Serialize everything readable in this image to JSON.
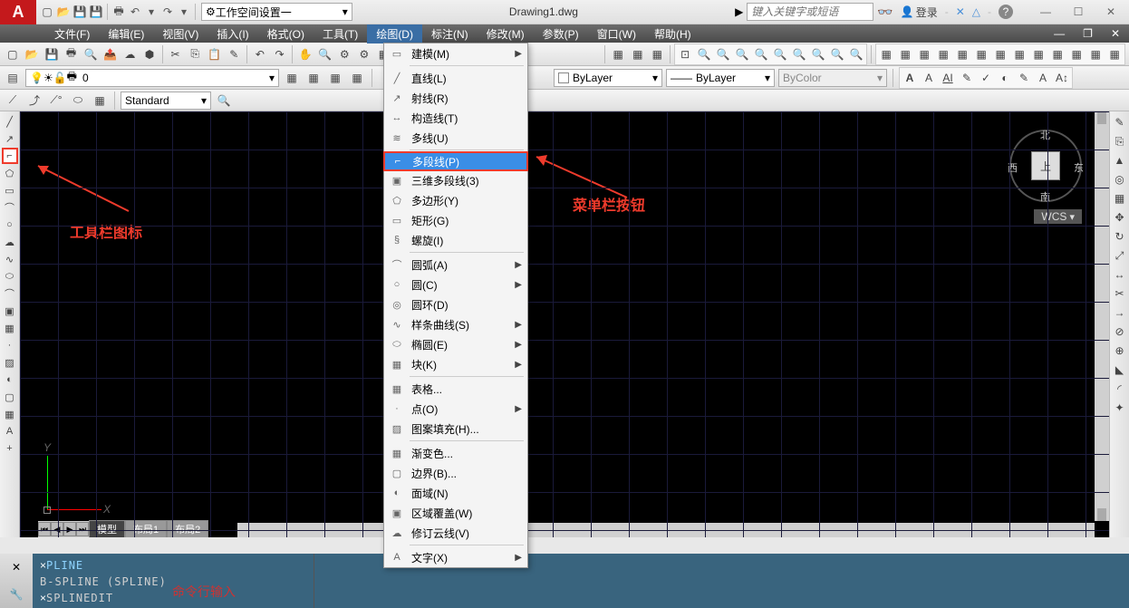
{
  "title": "Drawing1.dwg",
  "workspace": "工作空间设置一",
  "search_placeholder": "键入关键字或短语",
  "login": "登录",
  "menubar": [
    "文件(F)",
    "编辑(E)",
    "视图(V)",
    "插入(I)",
    "格式(O)",
    "工具(T)",
    "绘图(D)",
    "标注(N)",
    "修改(M)",
    "参数(P)",
    "窗口(W)",
    "帮助(H)"
  ],
  "active_menu_index": 6,
  "layer": {
    "current": "0"
  },
  "props": {
    "bylayer1": "ByLayer",
    "bylayer2": "ByLayer",
    "bycolor": "ByColor"
  },
  "style": {
    "standard": "Standard"
  },
  "dropdown": {
    "items": [
      {
        "icon": "▭",
        "label": "建模(M)",
        "arrow": true
      },
      {
        "sep": true
      },
      {
        "icon": "╱",
        "label": "直线(L)"
      },
      {
        "icon": "↗",
        "label": "射线(R)"
      },
      {
        "icon": "↔",
        "label": "构造线(T)"
      },
      {
        "icon": "≋",
        "label": "多线(U)"
      },
      {
        "sep": true
      },
      {
        "icon": "⌐",
        "label": "多段线(P)",
        "highlighted": true
      },
      {
        "icon": "▣",
        "label": "三维多段线(3)"
      },
      {
        "icon": "⬠",
        "label": "多边形(Y)"
      },
      {
        "icon": "▭",
        "label": "矩形(G)"
      },
      {
        "icon": "§",
        "label": "螺旋(I)"
      },
      {
        "sep": true
      },
      {
        "icon": "⌒",
        "label": "圆弧(A)",
        "arrow": true
      },
      {
        "icon": "○",
        "label": "圆(C)",
        "arrow": true
      },
      {
        "icon": "◎",
        "label": "圆环(D)"
      },
      {
        "icon": "∿",
        "label": "样条曲线(S)",
        "arrow": true
      },
      {
        "icon": "⬭",
        "label": "椭圆(E)",
        "arrow": true
      },
      {
        "icon": "▦",
        "label": "块(K)",
        "arrow": true
      },
      {
        "sep": true
      },
      {
        "icon": "▦",
        "label": "表格..."
      },
      {
        "icon": "·",
        "label": "点(O)",
        "arrow": true
      },
      {
        "icon": "▨",
        "label": "图案填充(H)..."
      },
      {
        "sep": true
      },
      {
        "icon": "▦",
        "label": "渐变色..."
      },
      {
        "icon": "▢",
        "label": "边界(B)..."
      },
      {
        "icon": "◐",
        "label": "面域(N)"
      },
      {
        "icon": "▣",
        "label": "区域覆盖(W)"
      },
      {
        "icon": "☁",
        "label": "修订云线(V)"
      },
      {
        "sep": true
      },
      {
        "icon": "A",
        "label": "文字(X)",
        "arrow": true
      }
    ]
  },
  "anno": {
    "toolbar": "工具栏图标",
    "menubtn": "菜单栏按钮",
    "cmdline": "命令行输入"
  },
  "viewcube": {
    "top": "北",
    "right": "东",
    "bottom": "南",
    "left": "西",
    "face": "上"
  },
  "wcs": "WCS",
  "tabs": {
    "model": "模型",
    "layout1": "布局1",
    "layout2": "布局2"
  },
  "cmd": {
    "l1": "PLINE",
    "l2": "B-SPLINE (SPLINE)",
    "l3": "SPLINEDIT"
  },
  "ucs": {
    "x": "X",
    "y": "Y"
  },
  "win": {
    "min": "—",
    "max": "☐",
    "close": "✕"
  }
}
